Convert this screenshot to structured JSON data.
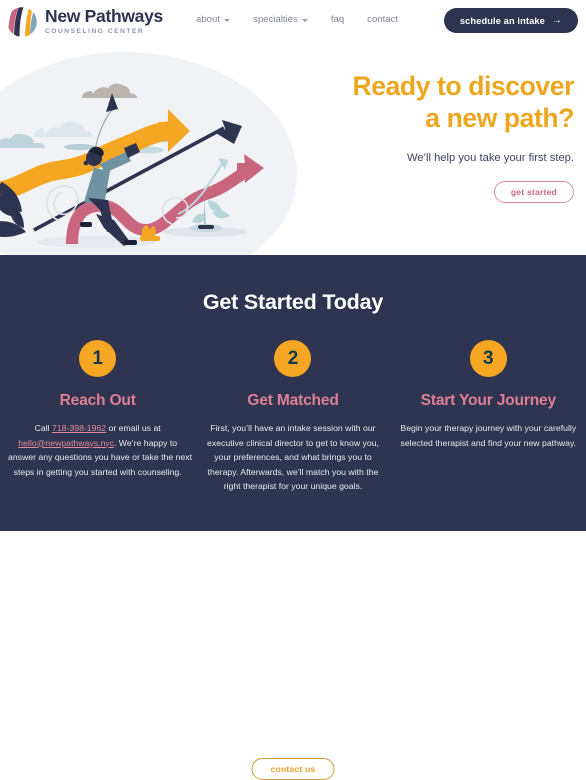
{
  "brand": {
    "title": "New Pathways",
    "subtitle": "COUNSELING CENTER",
    "logo_colors": [
      "#c9657f",
      "#2e3450",
      "#ffffff",
      "#f5a623",
      "#7fa8b8"
    ]
  },
  "nav": {
    "items": [
      {
        "label": "about",
        "has_dropdown": true
      },
      {
        "label": "specialties",
        "has_dropdown": true
      },
      {
        "label": "faq",
        "has_dropdown": false
      },
      {
        "label": "contact",
        "has_dropdown": false
      }
    ],
    "cta": {
      "label": "schedule an intake",
      "icon": "arrow-right",
      "arrow": "→"
    }
  },
  "hero": {
    "heading_line1": "Ready to discover",
    "heading_line2": "a new path?",
    "subtext": "We’ll help you take your first step.",
    "button": "get started",
    "heading_color": "#eda61f",
    "illustration": "person-with-telescope-on-arrows"
  },
  "section": {
    "title": "Get Started Today",
    "background": "#2f3450",
    "steps": [
      {
        "number": "1",
        "heading": "Reach Out",
        "lines": [
          "Call 718-398-1962 or email us at",
          "hello@newpathways.nyc. We’re happy to",
          "answer any questions you have or take the next",
          "steps in getting you started with counseling."
        ],
        "phone": "718-398-1962",
        "email": "hello@newpathways.nyc"
      },
      {
        "number": "2",
        "heading": "Get Matched",
        "lines": [
          "First, you’ll have an intake session with our",
          "executive clinical director to get to know you,",
          "your preferences, and what brings you to",
          "therapy. Afterwards, we’ll match you with the",
          "right therapist for your unique goals."
        ]
      },
      {
        "number": "3",
        "heading": "Start Your Journey",
        "lines": [
          "Begin your therapy journey with your carefully",
          "selected therapist and find your new pathway."
        ]
      }
    ],
    "button": "contact us"
  },
  "colors": {
    "navy": "#2f3450",
    "orange": "#f5a623",
    "amber": "#eda61f",
    "pink": "#dd7f96",
    "rose": "#c9657f",
    "blob": "#f0f2f5"
  }
}
